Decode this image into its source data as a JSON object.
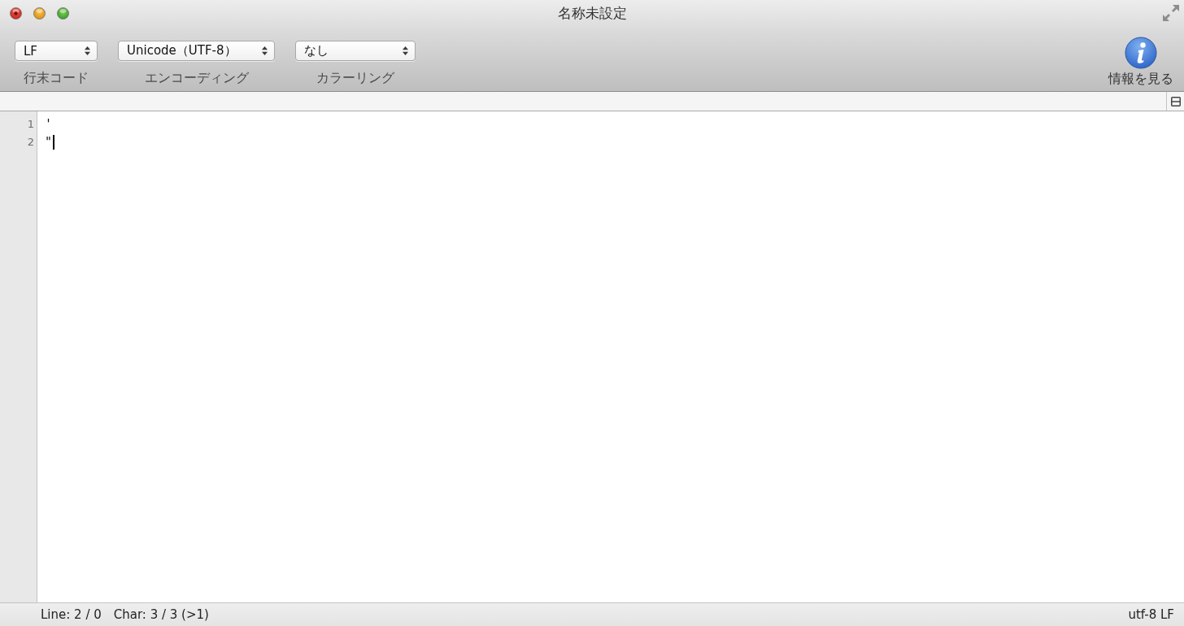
{
  "window": {
    "title": "名称未設定"
  },
  "toolbar": {
    "dropdowns": [
      {
        "value": "LF",
        "label": "行末コード"
      },
      {
        "value": "Unicode（UTF-8）",
        "label": "エンコーディング"
      },
      {
        "value": "なし",
        "label": "カラーリング"
      }
    ],
    "info_button": {
      "label": "情報を見る"
    }
  },
  "editor": {
    "lines": [
      {
        "number": "1",
        "text": "'",
        "caret": false
      },
      {
        "number": "2",
        "text": "\"",
        "caret": true
      }
    ]
  },
  "status_bar": {
    "line_info": "Line: 2 / 0",
    "char_info": "Char: 3 / 3 (>1)",
    "encoding": "utf-8 LF"
  }
}
